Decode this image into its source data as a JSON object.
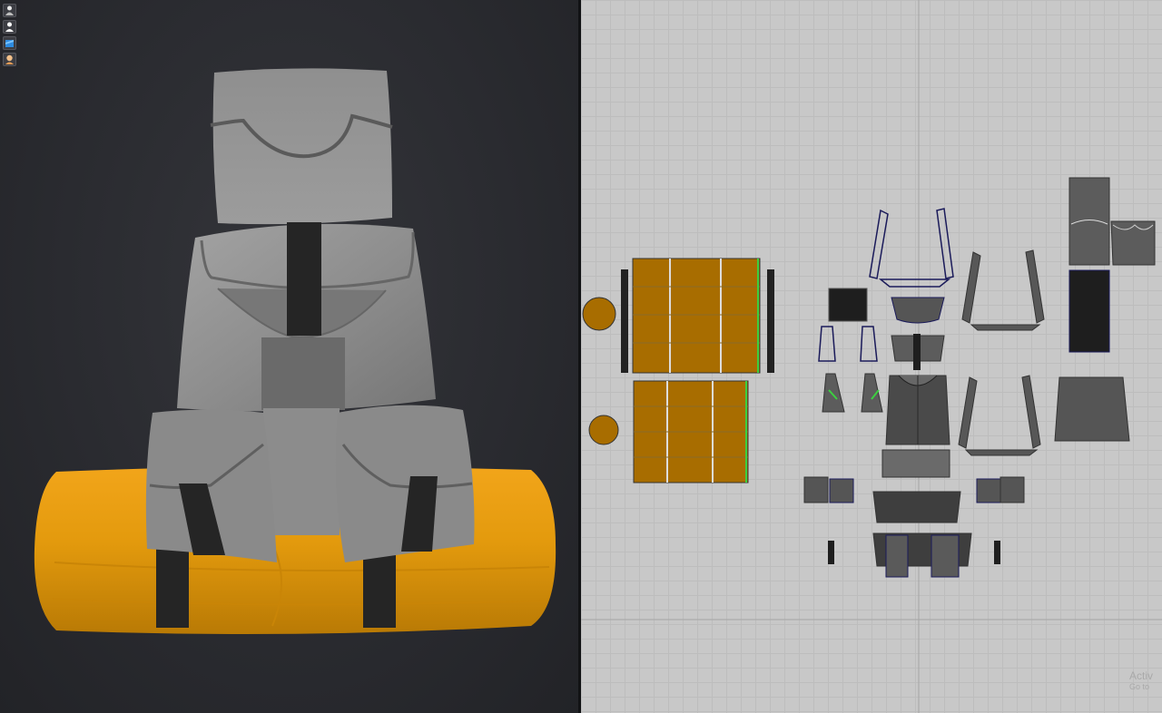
{
  "viewport_3d": {
    "toolbar": [
      {
        "name": "avatar-display-icon"
      },
      {
        "name": "avatar-silhouette-icon"
      },
      {
        "name": "garment-display-icon"
      },
      {
        "name": "skin-display-icon"
      }
    ]
  },
  "watermark": {
    "line1": "Activ",
    "line2": "Go to"
  },
  "colors": {
    "fabric_orange": "#a86d00",
    "bedroll_orange": "#e39a0d",
    "panel_dark": "#1e1e1e",
    "panel_gray": "#5c5c5c",
    "grid_bg": "#c8c8c8",
    "outline_blue": "#1a1a5a"
  }
}
